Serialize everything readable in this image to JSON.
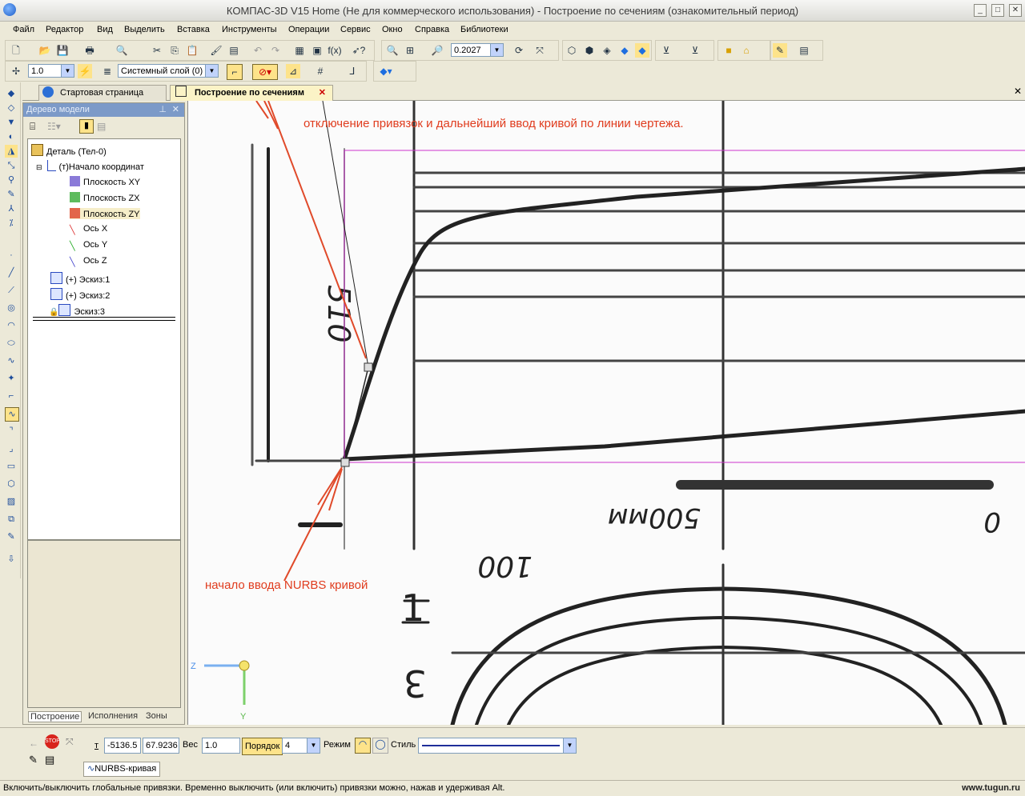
{
  "window": {
    "title": "КОМПАС-3D V15 Home (Не для коммерческого использования) - Построение по сечениям (ознакомительный период)"
  },
  "menu": [
    "Файл",
    "Редактор",
    "Вид",
    "Выделить",
    "Вставка",
    "Инструменты",
    "Операции",
    "Сервис",
    "Окно",
    "Справка",
    "Библиотеки"
  ],
  "toolbar": {
    "zoom_value": "0.2027",
    "step_value": "1.0",
    "layer_value": "Системный слой (0)"
  },
  "tabs": [
    {
      "label": "Стартовая страница",
      "active": false
    },
    {
      "label": "Построение по сечениям",
      "active": true
    }
  ],
  "tree": {
    "header": "Дерево модели",
    "items": [
      {
        "label": "Деталь (Тел-0)"
      },
      {
        "label": "(т)Начало координат"
      },
      {
        "label": "Плоскость XY"
      },
      {
        "label": "Плоскость ZX"
      },
      {
        "label": "Плоскость ZY"
      },
      {
        "label": "Ось X"
      },
      {
        "label": "Ось Y"
      },
      {
        "label": "Ось Z"
      },
      {
        "label": "(+) Эскиз:1"
      },
      {
        "label": "(+) Эскиз:2"
      },
      {
        "label": "Эскиз:3"
      }
    ],
    "bottom_tabs": [
      "Построение",
      "Исполнения",
      "Зоны"
    ]
  },
  "canvas": {
    "annotation_top": "отключение привязок и дальнейший ввод кривой по линии чертежа.",
    "annotation_bottom": "начало ввода NURBS кривой",
    "drawing_labels": [
      "510",
      "500мм",
      "0",
      "100",
      "1",
      "3"
    ],
    "axis_z": "Z",
    "axis_y": "Y",
    "colors": {
      "frame": "#cc33cc",
      "annotation": "#e03c1e",
      "arrow": "#e04a2a"
    }
  },
  "properties": {
    "t_label": "т",
    "x_value": "-5136.5",
    "y_value": "67.9236",
    "weight_label": "Вес",
    "weight_value": "1.0",
    "order_label": "Порядок",
    "order_value": "4",
    "mode_label": "Режим",
    "style_label": "Стиль",
    "object_tab": "NURBS-кривая"
  },
  "status": {
    "message": "Включить/выключить глобальные привязки. Временно выключить (или включить) привязки можно, нажав и удерживая Alt.",
    "watermark": "www.tugun.ru"
  }
}
